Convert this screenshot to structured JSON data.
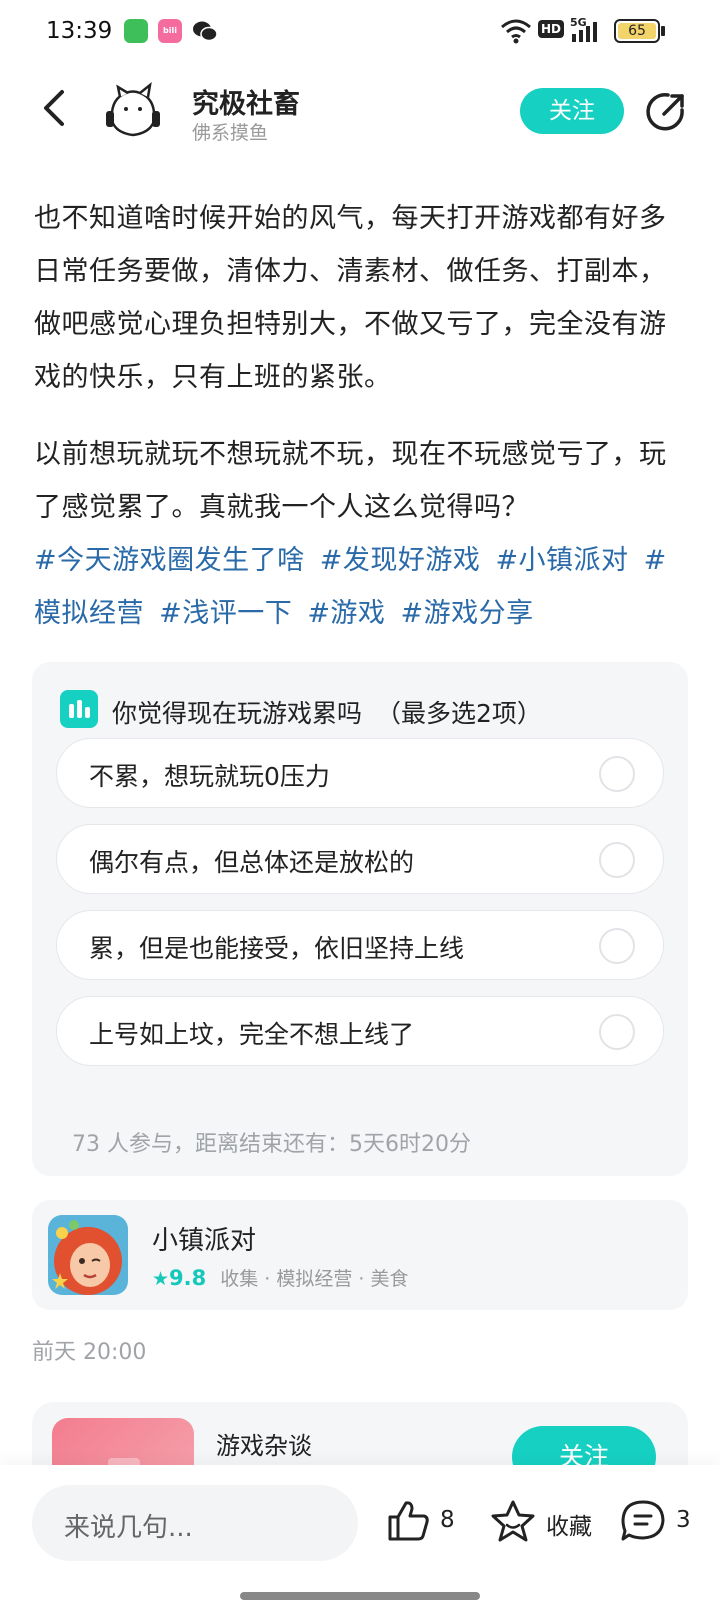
{
  "status_bar": {
    "time": "13:39",
    "battery": "65",
    "hd_label": "HD",
    "signal_label": "5G"
  },
  "header": {
    "author_name": "究极社畜",
    "author_subtitle": "佛系摸鱼",
    "follow_label": "关注"
  },
  "post": {
    "paragraphs": [
      "也不知道啥时候开始的风气，每天打开游戏都有好多日常任务要做，清体力、清素材、做任务、打副本，做吧感觉心理负担特别大，不做又亏了，完全没有游戏的快乐，只有上班的紧张。",
      "以前想玩就玩不想玩就不玩，现在不玩感觉亏了，玩了感觉累了。真就我一个人这么觉得吗？"
    ],
    "tags": [
      "#今天游戏圈发生了啥",
      "#发现好游戏",
      "#小镇派对",
      "#模拟经营",
      "#浅评一下",
      "#游戏",
      "#游戏分享"
    ]
  },
  "poll": {
    "title": "你觉得现在玩游戏累吗",
    "hint": "（最多选2项）",
    "options": [
      "不累，想玩就玩0压力",
      "偶尔有点，但总体还是放松的",
      "累，但是也能接受，依旧坚持上线",
      "上号如上坟，完全不想上线了"
    ],
    "stats": "73 人参与，距离结束还有：5天6时20分"
  },
  "game": {
    "name": "小镇派对",
    "rating": "9.8",
    "tags": "收集 · 模拟经营 · 美食"
  },
  "timestamp": "前天 20:00",
  "circle": {
    "name": "游戏杂谈",
    "follow_label": "关注"
  },
  "bottom": {
    "comment_placeholder": "来说几句...",
    "like_count": "8",
    "favorite_label": "收藏",
    "comment_count": "3"
  },
  "colors": {
    "accent": "#16d1c2",
    "tag_link": "#2a6aa8"
  }
}
